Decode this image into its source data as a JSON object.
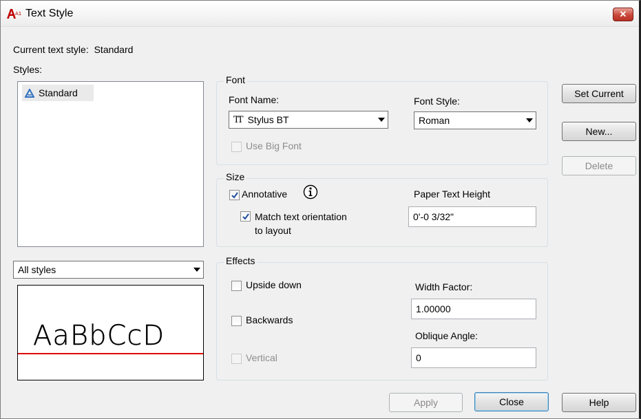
{
  "window": {
    "title": "Text Style",
    "app_icon_text": "A10"
  },
  "current_style": {
    "label": "Current text style:",
    "value": "Standard"
  },
  "styles": {
    "label": "Styles:",
    "items": [
      "Standard"
    ],
    "filter_selected": "All styles"
  },
  "preview": {
    "sample": "AaBbCcD",
    "baseline_color": "#e00000"
  },
  "font": {
    "group_label": "Font",
    "name_label": "Font Name:",
    "name_value": "Stylus BT",
    "style_label": "Font Style:",
    "style_value": "Roman",
    "big_font_label": "Use Big Font",
    "big_font_checked": false
  },
  "size": {
    "group_label": "Size",
    "annotative_label": "Annotative",
    "annotative_checked": true,
    "match_label_line1": "Match text orientation",
    "match_label_line2": "to layout",
    "match_checked": true,
    "height_label": "Paper Text Height",
    "height_value": "0'-0 3/32\""
  },
  "effects": {
    "group_label": "Effects",
    "upside_down_label": "Upside down",
    "backwards_label": "Backwards",
    "vertical_label": "Vertical",
    "width_label": "Width Factor:",
    "width_value": "1.00000",
    "oblique_label": "Oblique Angle:",
    "oblique_value": "0"
  },
  "buttons": {
    "set_current": "Set Current",
    "new": "New...",
    "delete": "Delete",
    "apply": "Apply",
    "close": "Close",
    "help": "Help"
  },
  "colors": {
    "check_mark": "#1f4e9a",
    "title_close": "#c9473a"
  }
}
